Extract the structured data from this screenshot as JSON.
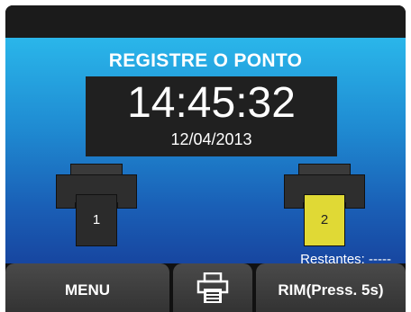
{
  "header": {
    "title": "REGISTRE O PONTO"
  },
  "clock": {
    "time": "14:45:32",
    "date": "12/04/2013"
  },
  "printers": [
    {
      "label": "1",
      "color": "#2b2b2b"
    },
    {
      "label": "2",
      "color": "#e0d935"
    }
  ],
  "status": {
    "restantes": "Restantes: -----"
  },
  "bottom_bar": {
    "menu_label": "MENU",
    "print_icon": "printer-icon",
    "rim_label": "RIM(Press. 5s)"
  }
}
